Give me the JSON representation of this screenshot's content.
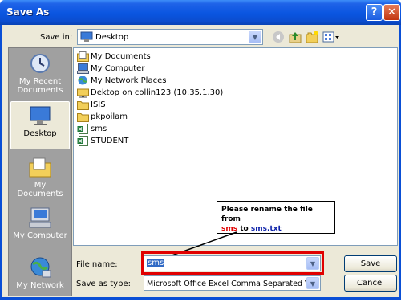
{
  "window": {
    "title": "Save As",
    "help_glyph": "?",
    "close_glyph": "✕"
  },
  "toolbar": {
    "save_in_label": "Save in:",
    "save_in_value": "Desktop"
  },
  "places": [
    {
      "label": "My Recent Documents",
      "icon": "recent-documents-icon"
    },
    {
      "label": "Desktop",
      "icon": "desktop-icon"
    },
    {
      "label": "My Documents",
      "icon": "my-documents-icon"
    },
    {
      "label": "My Computer",
      "icon": "my-computer-icon"
    },
    {
      "label": "My Network",
      "icon": "my-network-icon"
    }
  ],
  "files": [
    {
      "name": "My Documents",
      "icon": "my-documents-folder-icon"
    },
    {
      "name": "My Computer",
      "icon": "my-computer-icon"
    },
    {
      "name": "My Network Places",
      "icon": "network-places-icon"
    },
    {
      "name": "Dektop on collin123 (10.35.1.30)",
      "icon": "network-folder-icon"
    },
    {
      "name": "ISIS",
      "icon": "folder-icon"
    },
    {
      "name": "pkpoilam",
      "icon": "folder-icon"
    },
    {
      "name": "sms",
      "icon": "excel-file-icon"
    },
    {
      "name": "STUDENT",
      "icon": "excel-file-icon"
    }
  ],
  "filename": {
    "label": "File name:",
    "value": "sms"
  },
  "savetype": {
    "label": "Save as type:",
    "value": "Microsoft Office Excel Comma Separated Value"
  },
  "buttons": {
    "save": "Save",
    "cancel": "Cancel"
  },
  "annotation": {
    "line1": "Please rename the file from",
    "from": "sms",
    "to_word": "to",
    "target": "sms.txt"
  },
  "colors": {
    "title_bar": "#0a55e0",
    "highlight_box": "#e00000",
    "from_text": "#e00000",
    "target_text": "#0a1fa8"
  }
}
